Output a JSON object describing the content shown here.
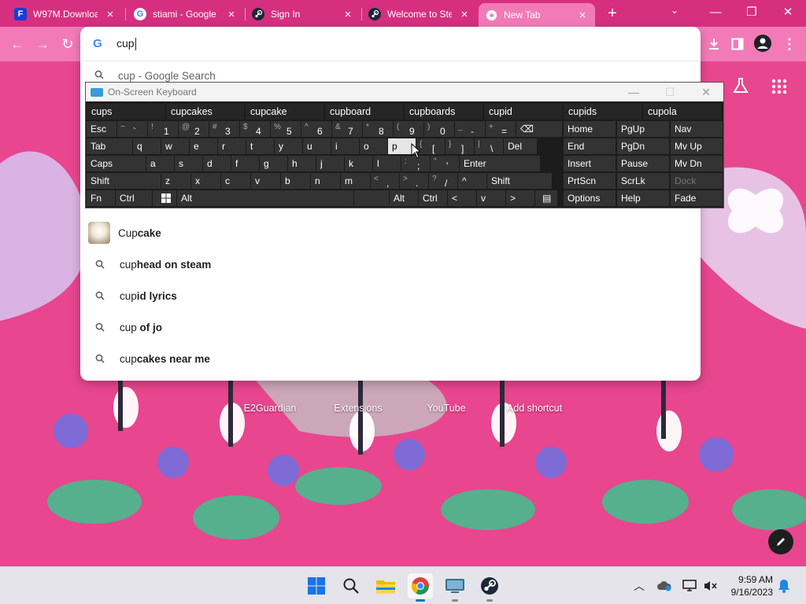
{
  "colors": {
    "chrome_frame": "#d62f7f",
    "toolbar": "#f27bb7",
    "page_background": "#e8468f",
    "keyboard_bg": "#1c1c1c",
    "key_bg": "#333333",
    "key_pressed": "#e6e6e6"
  },
  "tabs": [
    {
      "title": "W97M.Downloa",
      "icon": "f-letter-icon",
      "close": "×"
    },
    {
      "title": "stiami - Google",
      "icon": "google-icon",
      "close": "×"
    },
    {
      "title": "Sign In",
      "icon": "steam-icon",
      "close": "×"
    },
    {
      "title": "Welcome to Ste",
      "icon": "steam-icon",
      "close": "×"
    },
    {
      "title": "New Tab",
      "icon": "chrome-icon",
      "close": "×",
      "active": true
    }
  ],
  "new_tab_label": "+",
  "window_controls": {
    "minimize": "—",
    "maximize": "❐",
    "close": "✕"
  },
  "omnibox": {
    "value": "cup",
    "partial_suggestion": "cup - Google Search",
    "suggestions": [
      {
        "prefix": "Cup",
        "bold": "cake",
        "icon": "cupcake-thumbnail-icon"
      },
      {
        "prefix": "cup",
        "bold": "head on steam",
        "icon": "search-icon"
      },
      {
        "prefix": "cup",
        "bold": "id lyrics",
        "icon": "search-icon"
      },
      {
        "prefix": "cup ",
        "bold": "of jo",
        "icon": "search-icon"
      },
      {
        "prefix": "cup",
        "bold": "cakes near me",
        "icon": "search-icon"
      }
    ]
  },
  "osk": {
    "title": "On-Screen Keyboard",
    "minimize": "—",
    "maximize": "☐",
    "close": "✕",
    "predictions": [
      "cups",
      "cupcakes",
      "cupcake",
      "cupboard",
      "cupboards",
      "cupid",
      "cupids",
      "cupola"
    ],
    "row1": [
      {
        "main": "Esc"
      },
      {
        "shift": "~",
        "main": "`"
      },
      {
        "shift": "!",
        "main": "1"
      },
      {
        "shift": "@",
        "main": "2"
      },
      {
        "shift": "#",
        "main": "3"
      },
      {
        "shift": "$",
        "main": "4"
      },
      {
        "shift": "%",
        "main": "5"
      },
      {
        "shift": "^",
        "main": "6"
      },
      {
        "shift": "&",
        "main": "7"
      },
      {
        "shift": "*",
        "main": "8"
      },
      {
        "shift": "(",
        "main": "9"
      },
      {
        "shift": ")",
        "main": "0"
      },
      {
        "shift": "_",
        "main": "-"
      },
      {
        "shift": "+",
        "main": "="
      },
      {
        "main": "⌫"
      }
    ],
    "row2": [
      "Tab",
      "q",
      "w",
      "e",
      "r",
      "t",
      "y",
      "u",
      "i",
      "o",
      "p"
    ],
    "row2b": [
      {
        "shift": "{",
        "main": "["
      },
      {
        "shift": "}",
        "main": "]"
      },
      {
        "shift": "|",
        "main": "\\"
      },
      {
        "main": "Del"
      }
    ],
    "row3": [
      "Caps",
      "a",
      "s",
      "d",
      "f",
      "g",
      "h",
      "j",
      "k",
      "l"
    ],
    "row3b": [
      {
        "shift": ":",
        "main": ";"
      },
      {
        "shift": "\"",
        "main": "'"
      },
      {
        "main": "Enter"
      }
    ],
    "row4": [
      "Shift",
      "z",
      "x",
      "c",
      "v",
      "b",
      "n",
      "m"
    ],
    "row4b": [
      {
        "shift": "<",
        "main": ","
      },
      {
        "shift": ">",
        "main": "."
      },
      {
        "shift": "?",
        "main": "/"
      },
      {
        "main": "^"
      },
      {
        "main": "Shift"
      }
    ],
    "row5": [
      "Fn",
      "Ctrl",
      "",
      "Alt",
      "",
      "Alt",
      "Ctrl",
      "<",
      "v",
      ">",
      ""
    ],
    "nav": [
      [
        "Home",
        "PgUp",
        "Nav"
      ],
      [
        "End",
        "PgDn",
        "Mv Up"
      ],
      [
        "Insert",
        "Pause",
        "Mv Dn"
      ],
      [
        "PrtScn",
        "ScrLk",
        "Dock"
      ],
      [
        "Options",
        "Help",
        "Fade"
      ]
    ]
  },
  "shortcuts": [
    "E2Guardian",
    "Extensions",
    "YouTube",
    "Add shortcut"
  ],
  "clock": {
    "time": "9:59 AM",
    "date": "9/16/2023"
  }
}
